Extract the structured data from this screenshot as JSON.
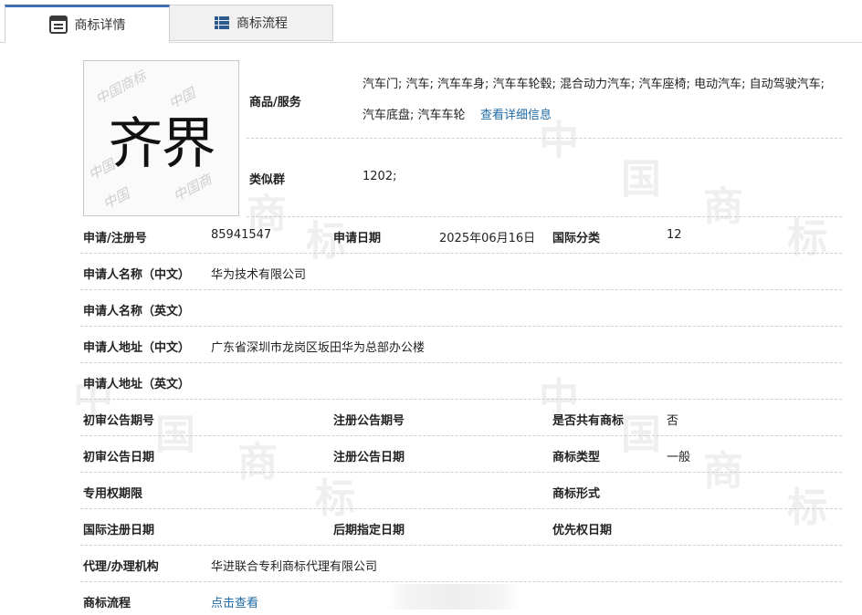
{
  "tabs": [
    {
      "label": "商标详情",
      "icon": "document-list-icon",
      "active": true
    },
    {
      "label": "商标流程",
      "icon": "grid-table-icon",
      "active": false
    }
  ],
  "watermark_glyphs": [
    "中",
    "国",
    "商",
    "标"
  ],
  "logo": {
    "mark_text": "齐界",
    "ghost_text": [
      "中国商标",
      "中国",
      "中国商"
    ]
  },
  "goods": {
    "label": "商品/服务",
    "value": "汽车门; 汽车; 汽车车身; 汽车车轮毂; 混合动力汽车; 汽车座椅; 电动汽车; 自动驾驶汽车; 汽车底盘; 汽车车轮",
    "detail_link": "查看详细信息"
  },
  "similar_group": {
    "label": "类似群",
    "value": "1202;"
  },
  "reg_no": {
    "label": "申请/注册号",
    "value": "85941547"
  },
  "apply_date": {
    "label": "申请日期",
    "value": "2025年06月16日"
  },
  "intl_class": {
    "label": "国际分类",
    "value": "12"
  },
  "applicant_cn": {
    "label": "申请人名称（中文）",
    "value": "华为技术有限公司"
  },
  "applicant_en": {
    "label": "申请人名称（英文）",
    "value": ""
  },
  "address_cn": {
    "label": "申请人地址（中文）",
    "value": "广东省深圳市龙岗区坂田华为总部办公楼"
  },
  "address_en": {
    "label": "申请人地址（英文）",
    "value": ""
  },
  "prelim_pub_no": {
    "label": "初审公告期号",
    "value": ""
  },
  "reg_pub_no": {
    "label": "注册公告期号",
    "value": ""
  },
  "shared": {
    "label": "是否共有商标",
    "value": "否"
  },
  "prelim_pub_date": {
    "label": "初审公告日期",
    "value": ""
  },
  "reg_pub_date": {
    "label": "注册公告日期",
    "value": ""
  },
  "mark_type": {
    "label": "商标类型",
    "value": "一般"
  },
  "exclusive_period": {
    "label": "专用权期限",
    "value": ""
  },
  "mark_form": {
    "label": "商标形式",
    "value": ""
  },
  "intl_reg_date": {
    "label": "国际注册日期",
    "value": ""
  },
  "later_designation": {
    "label": "后期指定日期",
    "value": ""
  },
  "priority_date": {
    "label": "优先权日期",
    "value": ""
  },
  "agency": {
    "label": "代理/办理机构",
    "value": "华进联合专利商标代理有限公司"
  },
  "process": {
    "label": "商标流程",
    "link": "点击查看"
  }
}
